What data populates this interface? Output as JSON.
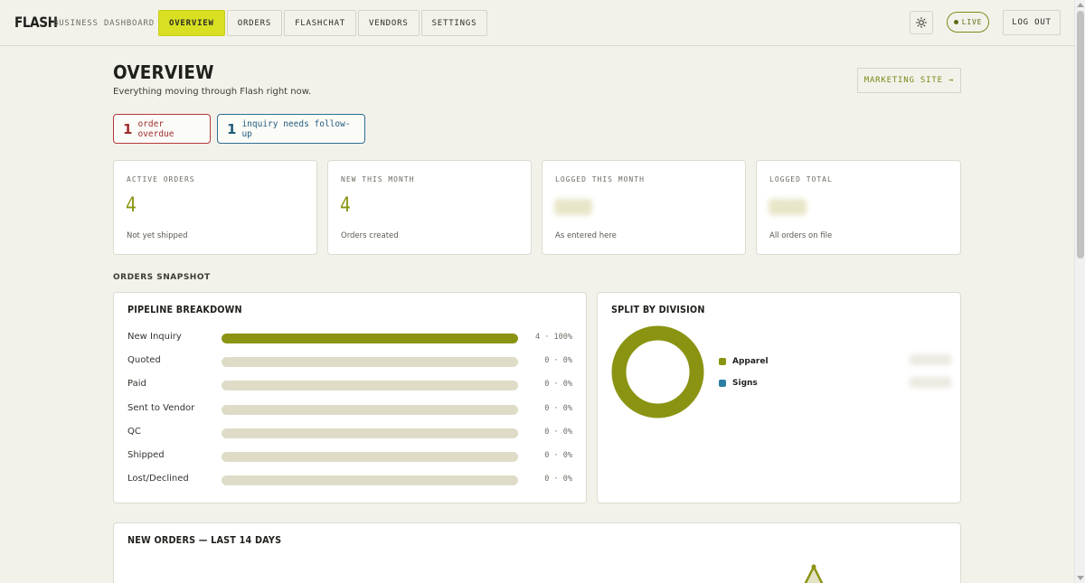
{
  "app": {
    "brand": "FLASH",
    "subtitle": "BUSINESS DASHBOARD"
  },
  "nav": {
    "items": [
      {
        "label": "OVERVIEW",
        "active": true
      },
      {
        "label": "ORDERS",
        "active": false
      },
      {
        "label": "FLASHCHAT",
        "active": false
      },
      {
        "label": "VENDORS",
        "active": false
      },
      {
        "label": "SETTINGS",
        "active": false
      }
    ],
    "live_label": "LIVE",
    "logout_label": "LOG OUT",
    "theme_icon": "sun-icon"
  },
  "header": {
    "title": "OVERVIEW",
    "subtitle": "Everything moving through Flash right now.",
    "marketing_label": "MARKETING SITE →"
  },
  "alerts": [
    {
      "count": "1",
      "text": "order overdue",
      "color": "#a12f2f"
    },
    {
      "count": "1",
      "text": "inquiry needs follow-up",
      "color": "#245d80"
    }
  ],
  "stats": [
    {
      "label": "ACTIVE ORDERS",
      "value": "4",
      "caption": "Not yet shipped"
    },
    {
      "label": "NEW THIS MONTH",
      "value": "4",
      "caption": "Orders created"
    },
    {
      "label": "LOGGED THIS MONTH",
      "value": "",
      "caption": "As entered here"
    },
    {
      "label": "LOGGED TOTAL",
      "value": "",
      "caption": "All orders on file"
    }
  ],
  "snapshot": {
    "section_label": "ORDERS SNAPSHOT",
    "pipeline": {
      "title": "PIPELINE BREAKDOWN",
      "rows": [
        {
          "label": "New Inquiry",
          "count": 4,
          "percent": 100,
          "display": "4 · 100%"
        },
        {
          "label": "Quoted",
          "count": 0,
          "percent": 0,
          "display": "0 · 0%"
        },
        {
          "label": "Paid",
          "count": 0,
          "percent": 0,
          "display": "0 · 0%"
        },
        {
          "label": "Sent to Vendor",
          "count": 0,
          "percent": 0,
          "display": "0 · 0%"
        },
        {
          "label": "QC",
          "count": 0,
          "percent": 0,
          "display": "0 · 0%"
        },
        {
          "label": "Shipped",
          "count": 0,
          "percent": 0,
          "display": "0 · 0%"
        },
        {
          "label": "Lost/Declined",
          "count": 0,
          "percent": 0,
          "display": "0 · 0%"
        }
      ]
    },
    "division": {
      "title": "SPLIT BY DIVISION",
      "legend": [
        {
          "label": "Apparel",
          "color": "#8a9412",
          "share": 1.0
        },
        {
          "label": "Signs",
          "color": "#2e7ea6",
          "share": 0.0
        }
      ]
    }
  },
  "new_orders": {
    "title": "NEW ORDERS — LAST 14 DAYS"
  },
  "colors": {
    "accent": "#d9e021",
    "olive": "#8a9412",
    "track": "#dedcc7"
  }
}
